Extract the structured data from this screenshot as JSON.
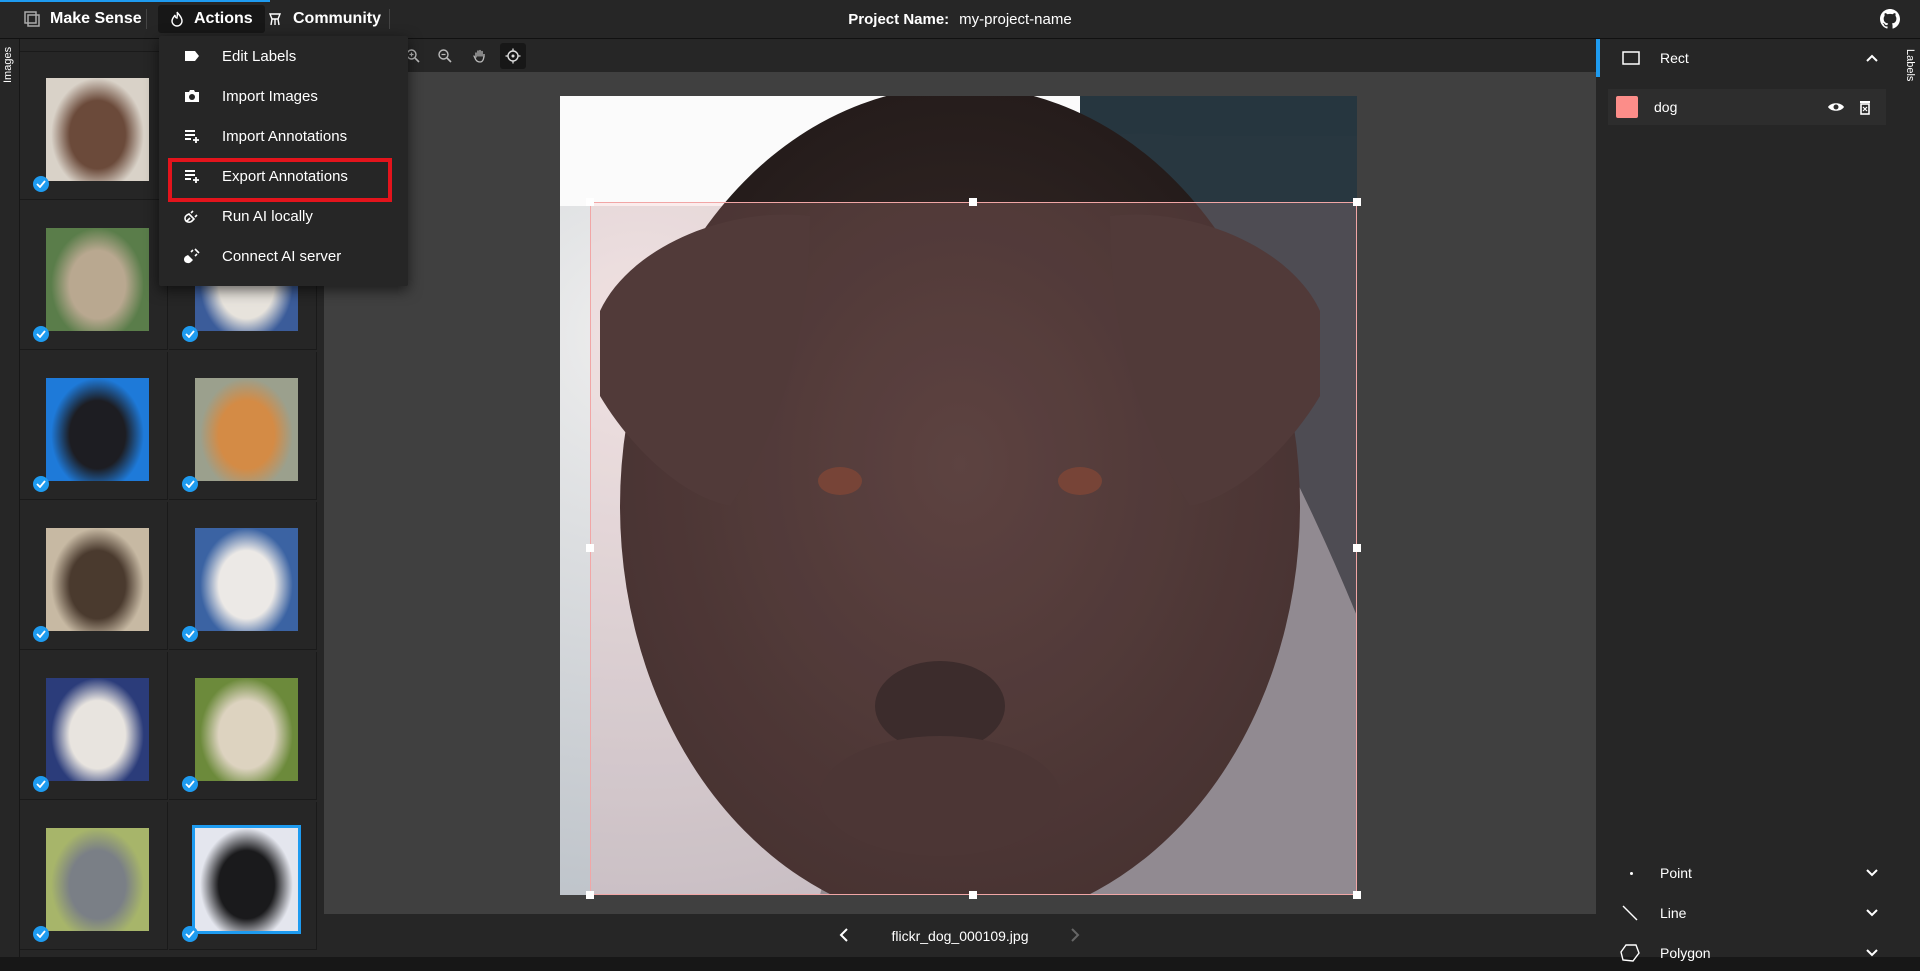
{
  "topbar": {
    "brand": "Make Sense",
    "actions_label": "Actions",
    "community_label": "Community",
    "project_label": "Project Name:",
    "project_name": "my-project-name"
  },
  "left_tab": {
    "label": "Images"
  },
  "right_tab": {
    "label": "Labels"
  },
  "actions_menu": {
    "items": [
      {
        "label": "Edit Labels",
        "icon": "label-tag-icon"
      },
      {
        "label": "Import Images",
        "icon": "camera-icon"
      },
      {
        "label": "Import Annotations",
        "icon": "import-list-icon"
      },
      {
        "label": "Export Annotations",
        "icon": "export-list-icon",
        "highlighted": true
      },
      {
        "label": "Run AI locally",
        "icon": "plug-icon"
      },
      {
        "label": "Connect AI server",
        "icon": "plug-server-icon"
      }
    ]
  },
  "image_list": {
    "thumbnails": [
      {
        "desc": "brown labrador",
        "checked": true,
        "selected": false,
        "colors": [
          "#6b4a3a",
          "#d9d2c8"
        ]
      },
      {
        "desc": "dog (hidden by menu)",
        "checked": false,
        "selected": false,
        "colors": [
          "#8b8b99",
          "#dcd8d0"
        ]
      },
      {
        "desc": "tan pup",
        "checked": true,
        "selected": false,
        "colors": [
          "#b9a890",
          "#5a7d4a"
        ]
      },
      {
        "desc": "white dog",
        "checked": true,
        "selected": false,
        "colors": [
          "#e7e3dc",
          "#3b5c9a"
        ]
      },
      {
        "desc": "black dog blue bg",
        "checked": true,
        "selected": false,
        "colors": [
          "#1d1d22",
          "#1e7ad9"
        ]
      },
      {
        "desc": "golden puppy",
        "checked": true,
        "selected": false,
        "colors": [
          "#d48b45",
          "#9ba08d"
        ]
      },
      {
        "desc": "brindle",
        "checked": true,
        "selected": false,
        "colors": [
          "#4a3a2e",
          "#c7b9a3"
        ]
      },
      {
        "desc": "white pit",
        "checked": true,
        "selected": false,
        "colors": [
          "#ece9e6",
          "#3b63a3"
        ]
      },
      {
        "desc": "tricolor",
        "checked": true,
        "selected": false,
        "colors": [
          "#e8e4df",
          "#2b3c7a"
        ]
      },
      {
        "desc": "husky mix",
        "checked": true,
        "selected": false,
        "colors": [
          "#ddd3c0",
          "#6c8a3b"
        ]
      },
      {
        "desc": "grey pit",
        "checked": true,
        "selected": false,
        "colors": [
          "#7a7f86",
          "#a7b56a"
        ]
      },
      {
        "desc": "black dog selected",
        "checked": true,
        "selected": true,
        "colors": [
          "#1a1a1c",
          "#e4e6ee"
        ]
      }
    ]
  },
  "bottombar": {
    "filename": "flickr_dog_000109.jpg"
  },
  "labels_panel": {
    "rect_header": "Rect",
    "labels": [
      {
        "name": "dog",
        "color": "#fc8d89"
      }
    ],
    "tools": [
      {
        "label": "Point"
      },
      {
        "label": "Line"
      },
      {
        "label": "Polygon"
      }
    ]
  },
  "colors": {
    "accent": "#1e9bf0",
    "highlight": "#e3141c",
    "panel": "#262626",
    "canvas": "#404040"
  }
}
